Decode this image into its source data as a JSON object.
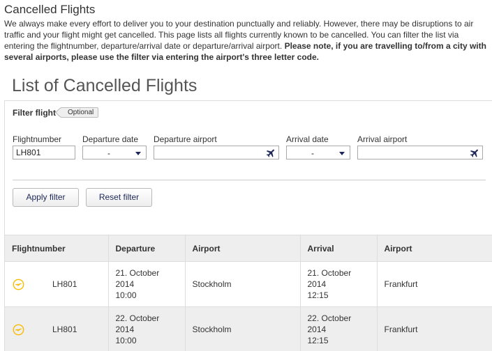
{
  "page": {
    "title": "Cancelled Flights",
    "intro_text": "We always make every effort to deliver you to your destination punctually and reliably. However, there may be disruptions to air traffic and your flight might get cancelled. This page lists all flights currently known to be cancelled. You can filter the list via entering the flightnumber, departure/arrival date or departure/arrival airport. ",
    "intro_bold": "Please note, if you are travelling to/from a city with several airports, please use the filter via entering the airport's three letter code."
  },
  "list_title": "List of Cancelled Flights",
  "filter": {
    "heading": "Filter flight",
    "optional_tag": "Optional",
    "flightnumber_label": "Flightnumber",
    "flightnumber_value": "LH801",
    "departure_date_label": "Departure date",
    "departure_date_value": "-",
    "departure_airport_label": "Departure airport",
    "departure_airport_value": "",
    "arrival_date_label": "Arrival date",
    "arrival_date_value": "-",
    "arrival_airport_label": "Arrival airport",
    "arrival_airport_value": "",
    "apply_label": "Apply filter",
    "reset_label": "Reset filter"
  },
  "table": {
    "headers": [
      "Flightnumber",
      "Departure",
      "Airport",
      "Arrival",
      "Airport"
    ],
    "rows": [
      {
        "flightnumber": "LH801",
        "departure_date": "21. October",
        "departure_year": "2014",
        "departure_time": "10:00",
        "departure_airport": "Stockholm",
        "arrival_date": "21. October",
        "arrival_year": "2014",
        "arrival_time": "12:15",
        "arrival_airport": "Frankfurt"
      },
      {
        "flightnumber": "LH801",
        "departure_date": "22. October",
        "departure_year": "2014",
        "departure_time": "10:00",
        "departure_airport": "Stockholm",
        "arrival_date": "22. October",
        "arrival_year": "2014",
        "arrival_time": "12:15",
        "arrival_airport": "Frankfurt"
      }
    ]
  },
  "colors": {
    "brand_navy": "#1d2858",
    "brand_yellow": "#f9ba00",
    "header_bg": "#eeeeee"
  },
  "icons": {
    "airline": "crane-logo-icon",
    "airport_picker": "airplane-icon",
    "dropdown": "chevron-down-icon"
  }
}
